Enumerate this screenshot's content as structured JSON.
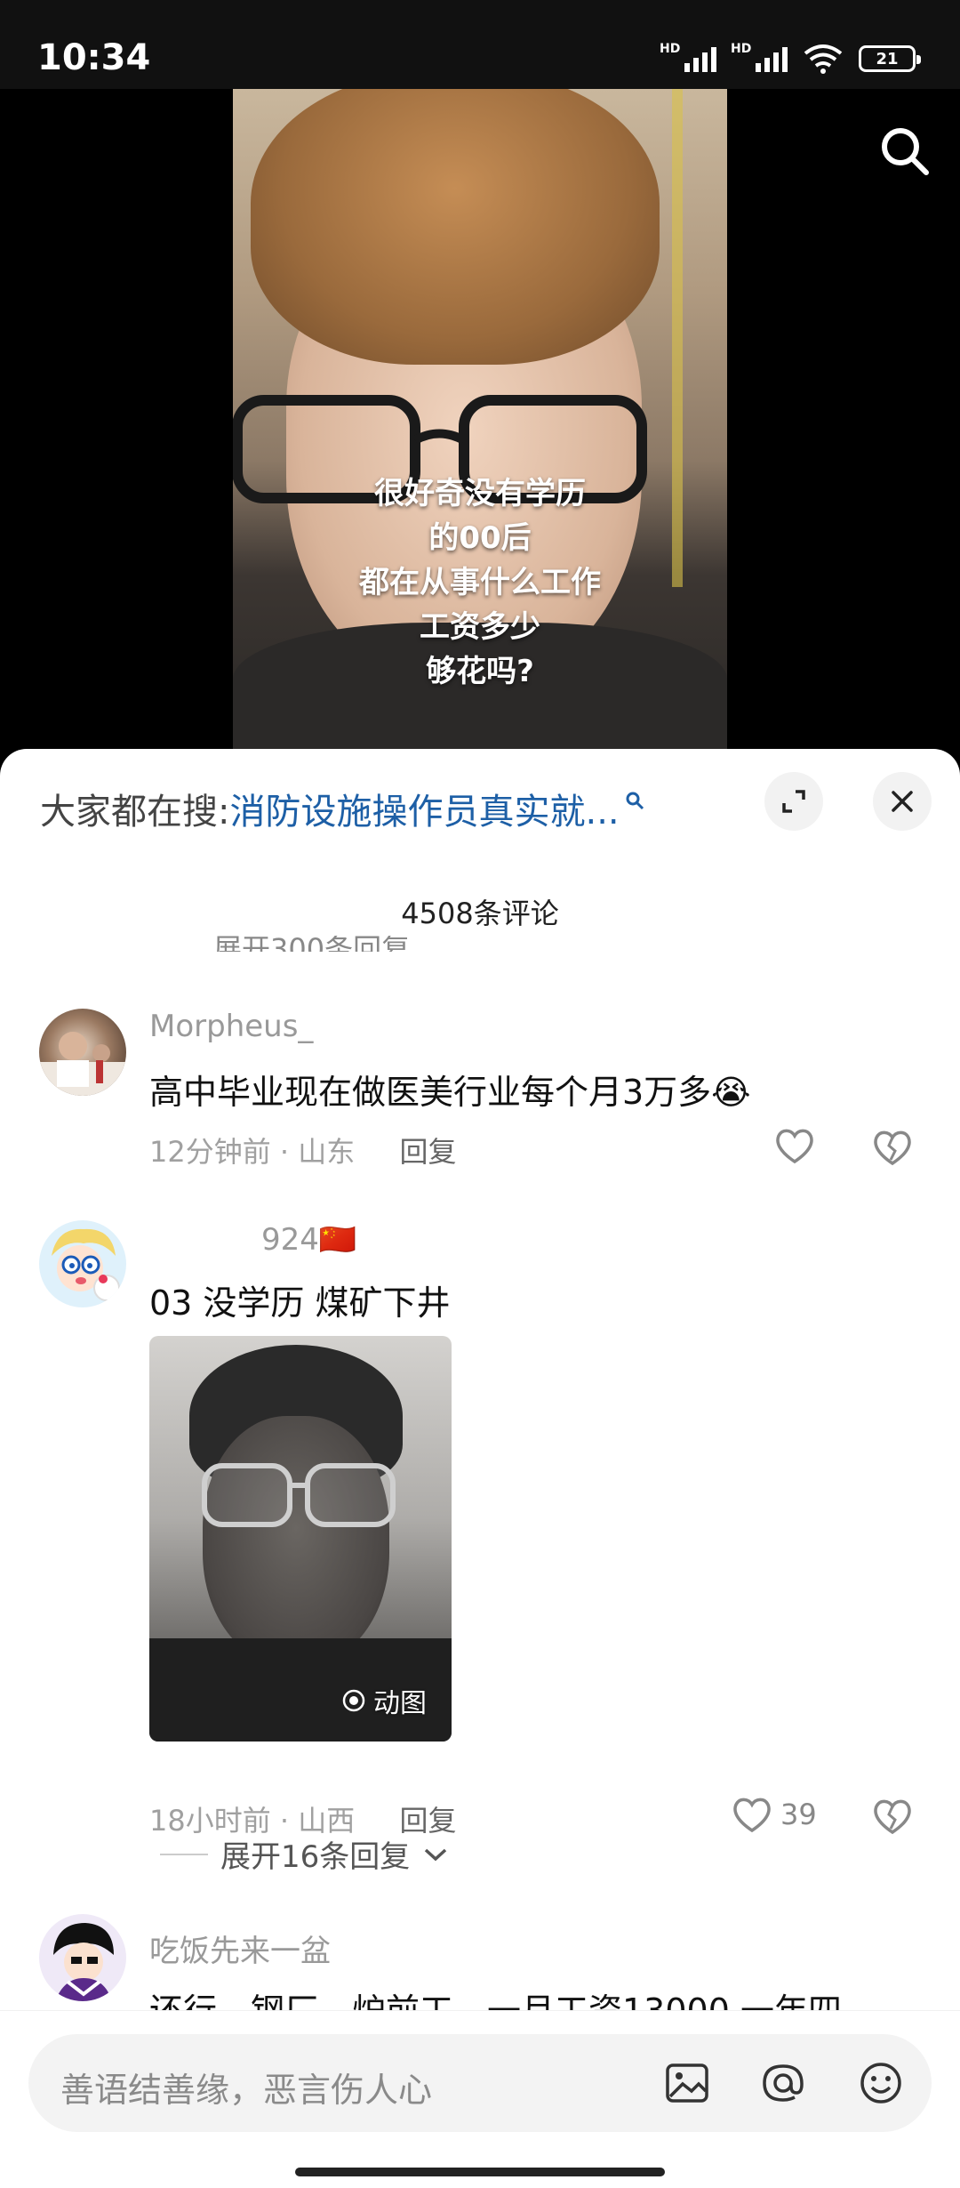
{
  "status_bar": {
    "time": "10:34",
    "signal_1_label": "HD",
    "signal_2_label": "HD",
    "battery": "21"
  },
  "video": {
    "caption_lines": [
      "很好奇没有学历",
      "的00后",
      "都在从事什么工作",
      "工资多少",
      "够花吗?"
    ],
    "search_icon": "search-icon"
  },
  "sheet": {
    "search_hint_label": "大家都在搜:",
    "search_hint_link": "消防设施操作员真实就...",
    "comment_count": "4508条评论",
    "ghost_text": "展开300条回复"
  },
  "comments": [
    {
      "username": "Morpheus_",
      "text": "高中毕业现在做医美行业每个月3万多😭",
      "time": "12分钟前",
      "location": "山东",
      "reply": "回复",
      "likes": ""
    },
    {
      "username": "924🇨🇳",
      "text": "03 没学历 煤矿下井",
      "media_label": "动图",
      "time": "18小时前",
      "location": "山西",
      "reply": "回复",
      "likes": "39",
      "expand_replies": "展开16条回复"
    },
    {
      "username": "吃饭先来一盆",
      "text": "还行，钢厂，炉前工，一月工资13000  一年四"
    }
  ],
  "input_bar": {
    "placeholder": "善语结善缘，恶言伤人心"
  }
}
